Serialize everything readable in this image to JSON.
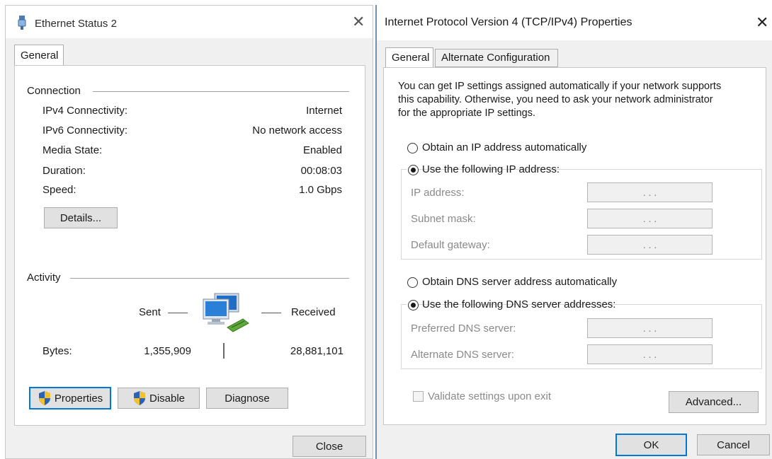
{
  "left_window": {
    "title": "Ethernet Status 2",
    "tab_general": "General",
    "connection": {
      "heading": "Connection",
      "rows": [
        {
          "label": "IPv4 Connectivity:",
          "value": "Internet"
        },
        {
          "label": "IPv6 Connectivity:",
          "value": "No network access"
        },
        {
          "label": "Media State:",
          "value": "Enabled"
        },
        {
          "label": "Duration:",
          "value": "00:08:03"
        },
        {
          "label": "Speed:",
          "value": "1.0 Gbps"
        }
      ],
      "details_button": "Details..."
    },
    "activity": {
      "heading": "Activity",
      "sent_label": "Sent",
      "received_label": "Received",
      "bytes_label": "Bytes:",
      "bytes_sent": "1,355,909",
      "bytes_received": "28,881,101"
    },
    "buttons": {
      "properties": "Properties",
      "disable": "Disable",
      "diagnose": "Diagnose",
      "close": "Close"
    }
  },
  "right_window": {
    "title": "Internet Protocol Version 4 (TCP/IPv4) Properties",
    "tabs": [
      "General",
      "Alternate Configuration"
    ],
    "intro_lines": [
      "You can get IP settings assigned automatically if your network supports",
      "this capability. Otherwise, you need to ask your network administrator",
      "for the appropriate IP settings."
    ],
    "ip_auto_label": "Obtain an IP address automatically",
    "ip_manual_label": "Use the following IP address:",
    "ip_fields": [
      {
        "label": "IP address:",
        "value": ". . ."
      },
      {
        "label": "Subnet mask:",
        "value": ". . ."
      },
      {
        "label": "Default gateway:",
        "value": ". . ."
      }
    ],
    "dns_auto_label": "Obtain DNS server address automatically",
    "dns_manual_label": "Use the following DNS server addresses:",
    "dns_fields": [
      {
        "label": "Preferred DNS server:",
        "value": ". . ."
      },
      {
        "label": "Alternate DNS server:",
        "value": ". . ."
      }
    ],
    "validate_label": "Validate settings upon exit",
    "advanced_button": "Advanced...",
    "ok_button": "OK",
    "cancel_button": "Cancel"
  },
  "colors": {
    "focus_border": "#0078d7",
    "window_bg": "#f0f0f0"
  },
  "icons": [
    "ethernet-icon",
    "network-computers-icon",
    "uac-shield-icon"
  ]
}
